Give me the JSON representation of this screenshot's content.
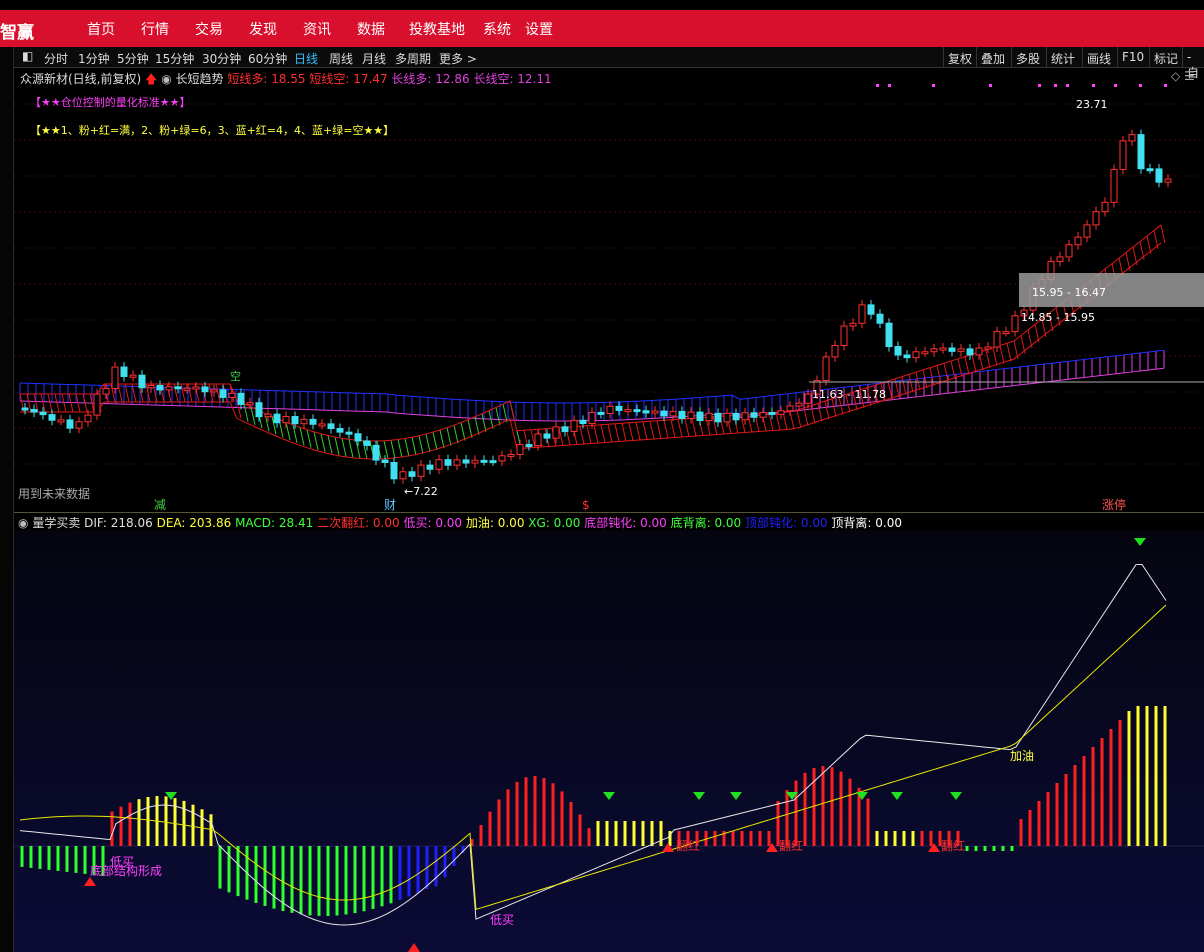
{
  "app": {
    "logo": "智赢",
    "menu": [
      "首页",
      "行情",
      "交易",
      "发现",
      "资讯",
      "数据",
      "投教基地",
      "系统",
      "设置"
    ]
  },
  "toolbar": {
    "periods": [
      "分时",
      "1分钟",
      "5分钟",
      "15分钟",
      "30分钟",
      "60分钟",
      "日线",
      "周线",
      "月线",
      "多周期",
      "更多"
    ],
    "active_period": "日线",
    "more_arrow": ">",
    "right": [
      "复权",
      "叠加",
      "多股",
      "统计",
      "画线",
      "F10",
      "标记",
      "-自"
    ]
  },
  "main": {
    "stock": "众源新材(日线,前复权)",
    "indicator": "长短趋势",
    "legend": [
      {
        "label": "短线多: 18.55",
        "color": "#ff3030"
      },
      {
        "label": "短线空: 17.47",
        "color": "#ff3030"
      },
      {
        "label": "长线多: 12.86",
        "color": "#e040e0"
      },
      {
        "label": "长线空: 12.11",
        "color": "#e040e0"
      }
    ],
    "note1": "【★★仓位控制的量化标准★★】",
    "note2": "【★★1、粉+红=满，2、粉+绿=6，3、蓝+红=4，4、蓝+绿=空★★】",
    "future_text": "用到未来数据",
    "price_high": "23.71",
    "price_low": "7.22",
    "zone1": "15.95 - 16.47",
    "zone2": "14.85 - 15.95",
    "zone3": "11.63 - 11.78",
    "kong_label": "空",
    "bottom_markers": [
      {
        "label": "减",
        "color": "#40d040"
      },
      {
        "label": "财",
        "color": "#60c0ff"
      },
      {
        "label": "$",
        "color": "#ff3030"
      },
      {
        "label": "涨停",
        "color": "#ff5050"
      }
    ]
  },
  "sub": {
    "title": "量学买卖",
    "values": [
      {
        "label": "DIF: 218.06",
        "color": "#e0e0e0"
      },
      {
        "label": "DEA: 203.86",
        "color": "#ffff40"
      },
      {
        "label": "MACD: 28.41",
        "color": "#40ff40"
      },
      {
        "label": "二次翻红: 0.00",
        "color": "#ff3030"
      },
      {
        "label": "低买: 0.00",
        "color": "#ff40ff"
      },
      {
        "label": "加油: 0.00",
        "color": "#ffff40"
      },
      {
        "label": "XG: 0.00",
        "color": "#40ff40"
      },
      {
        "label": "底部钝化: 0.00",
        "color": "#ff40ff"
      },
      {
        "label": "底背离: 0.00",
        "color": "#40ff40"
      },
      {
        "label": "顶部钝化: 0.00",
        "color": "#2020ff"
      },
      {
        "label": "顶背离: 0.00",
        "color": "#ffffff"
      }
    ],
    "labels": {
      "low_buy": "低买",
      "bottom_structure": "底部结构形成",
      "turn_red": "翻红",
      "refuel": "加油"
    }
  },
  "colors": {
    "topbar": "#d8102e",
    "up": "#ff3030",
    "down": "#40e0f0",
    "band_short_up": "#e01818",
    "band_short_down": "#30d030",
    "band_long_up": "#e040e0",
    "band_long_down": "#2030ff"
  }
}
